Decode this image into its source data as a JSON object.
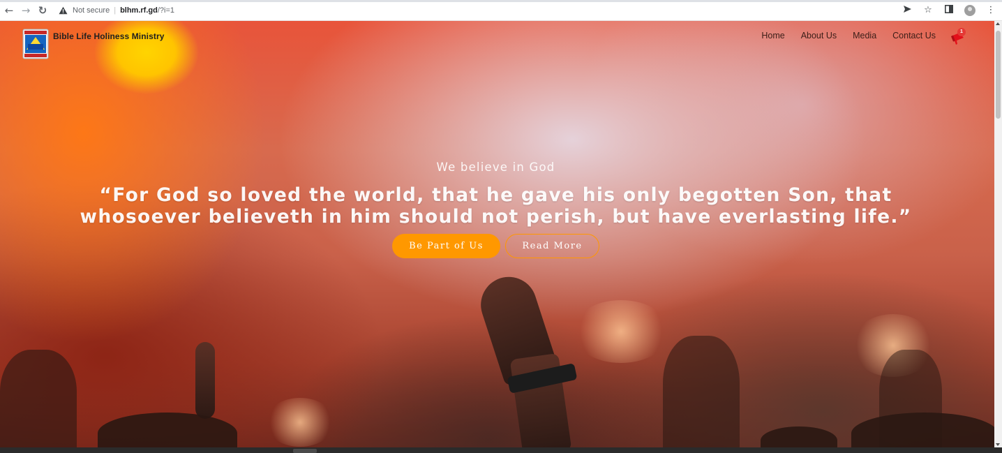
{
  "browser": {
    "security_label": "Not secure",
    "separator": "|",
    "host": "blhm.rf.gd",
    "path": "/?i=1",
    "icons": [
      "back-arrow-icon",
      "forward-arrow-icon",
      "reload-icon",
      "warning-icon",
      "send-icon",
      "star-icon",
      "side-panel-icon",
      "profile-icon",
      "menu-kebab-icon"
    ]
  },
  "site": {
    "name": "Bible Life Holiness Ministry",
    "logo_text": "HOLINESS",
    "nav": {
      "home": "Home",
      "about": "About Us",
      "media": "Media",
      "contact": "Contact Us"
    },
    "notification_count": "1"
  },
  "hero": {
    "kicker": "We believe in God",
    "quote": "“For God so loved the world, that he gave his only begotten Son, that whosoever believeth in him should not perish, but have everlasting life.”",
    "primary_button": "Be Part of Us",
    "secondary_button": "Read More"
  },
  "colors": {
    "accent": "#ff9800",
    "badge": "#e53935",
    "nav_text": "#3b1d17"
  }
}
